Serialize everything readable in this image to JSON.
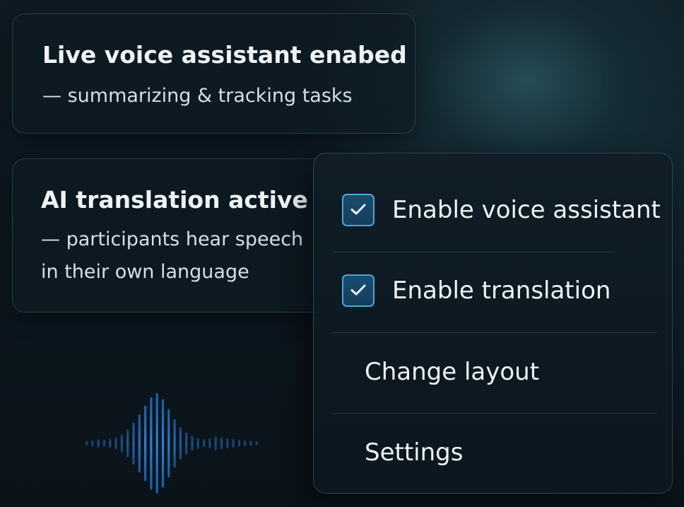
{
  "cards": {
    "voice_assistant": {
      "title": "Live voice assistant enabed",
      "subtitle": "— summarizing & tracking tasks"
    },
    "translation": {
      "title": "AI translation active",
      "subtitle_line1": "— participants hear speech",
      "subtitle_line2": "in their own language"
    }
  },
  "menu": {
    "items": [
      {
        "label": "Enable voice assistant",
        "checked": true,
        "icon": "checkmark-icon"
      },
      {
        "label": "Enable translation",
        "checked": true,
        "icon": "checkmark-icon"
      },
      {
        "label": "Change layout",
        "checked": false
      },
      {
        "label": "Settings",
        "checked": false
      }
    ]
  },
  "waveform": {
    "icon": "audio-waveform-icon",
    "color": "#2f7fd8",
    "levels": [
      0.04,
      0.06,
      0.08,
      0.07,
      0.09,
      0.12,
      0.18,
      0.28,
      0.42,
      0.58,
      0.75,
      0.92,
      1.0,
      0.88,
      0.68,
      0.48,
      0.32,
      0.22,
      0.15,
      0.11,
      0.08,
      0.1,
      0.14,
      0.12,
      0.1,
      0.09,
      0.07,
      0.06,
      0.05,
      0.04
    ]
  },
  "colors": {
    "accent": "#4ea6d6",
    "checkbox_fill": "#1b4c6e",
    "text_primary": "#eef3f6",
    "background": "#0c161e"
  }
}
